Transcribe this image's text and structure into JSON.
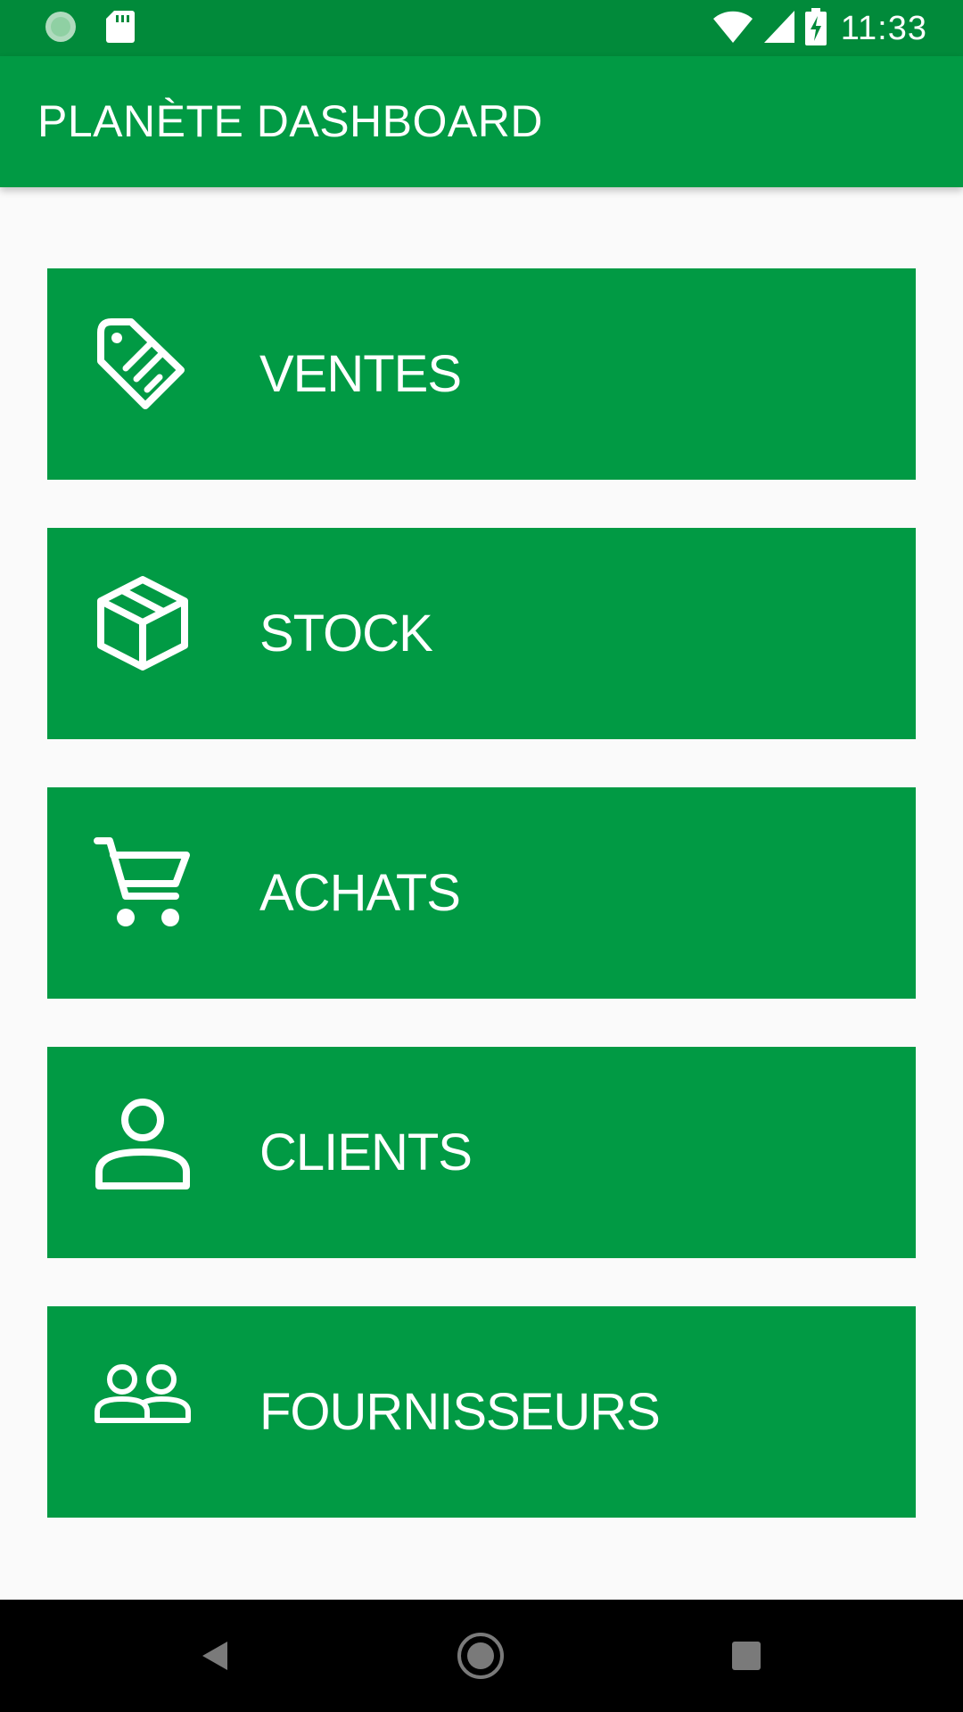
{
  "status_bar": {
    "time": "11:33",
    "icons": [
      "sync-circle-icon",
      "sd-card-icon",
      "wifi-icon",
      "signal-icon",
      "battery-charging-icon"
    ]
  },
  "app_bar": {
    "title": "PLANÈTE DASHBOARD"
  },
  "menu": {
    "items": [
      {
        "label": "VENTES",
        "icon": "sale-tag-icon"
      },
      {
        "label": "STOCK",
        "icon": "package-box-icon"
      },
      {
        "label": "ACHATS",
        "icon": "shopping-cart-icon"
      },
      {
        "label": "CLIENTS",
        "icon": "person-icon"
      },
      {
        "label": "FOURNISSEURS",
        "icon": "people-group-icon"
      }
    ]
  },
  "nav_bar": {
    "buttons": [
      "back-icon",
      "home-icon",
      "recents-icon"
    ]
  },
  "colors": {
    "status_bar": "#018a3a",
    "primary": "#019a44",
    "background": "#fafafa",
    "nav_bar": "#000000"
  }
}
